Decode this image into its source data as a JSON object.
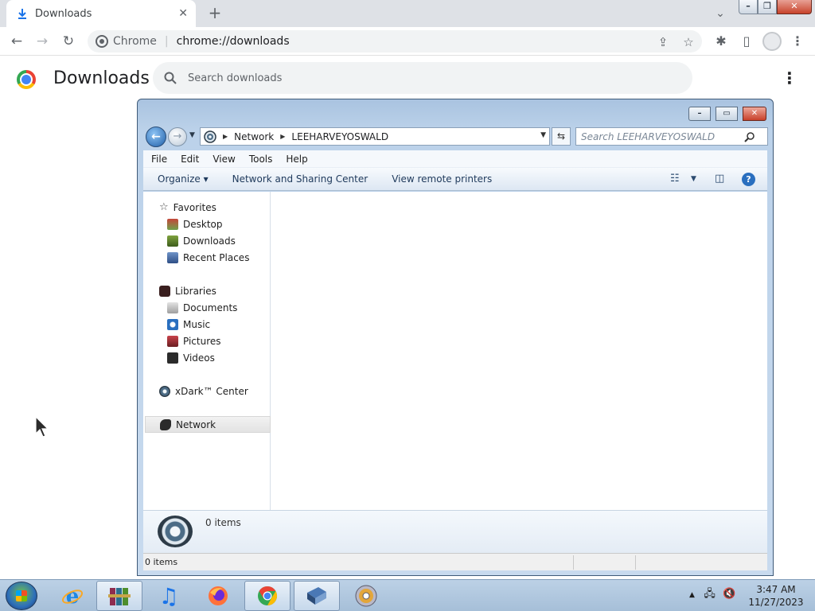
{
  "browser": {
    "tab": {
      "title": "Downloads",
      "icon": "download-icon",
      "close": "✕"
    },
    "new_tab_label": "+",
    "tab_search": "⌄",
    "window_controls": {
      "minimize": "–",
      "maximize": "❐",
      "close": "✕"
    },
    "omnibox": {
      "site_name": "Chrome",
      "url": "chrome://downloads"
    }
  },
  "downloads_page": {
    "title": "Downloads",
    "search_placeholder": "Search downloads",
    "menu": "⋮"
  },
  "explorer": {
    "window_controls": {
      "minimize": "–",
      "maximize": "▭",
      "close": "✕"
    },
    "breadcrumb": [
      "Network",
      "LEEHARVEYOSWALD"
    ],
    "search_placeholder": "Search LEEHARVEYOSWALD",
    "menu": [
      "File",
      "Edit",
      "View",
      "Tools",
      "Help"
    ],
    "commands": {
      "organize": "Organize ▾",
      "network_sharing": "Network and Sharing Center",
      "remote_printers": "View remote printers"
    },
    "help": "?",
    "nav": {
      "favorites": {
        "label": "Favorites",
        "items": [
          "Desktop",
          "Downloads",
          "Recent Places"
        ]
      },
      "libraries": {
        "label": "Libraries",
        "items": [
          "Documents",
          "Music",
          "Pictures",
          "Videos"
        ]
      },
      "xdark": "xDark™ Center",
      "network": "Network"
    },
    "details_count": "0 items",
    "status_count": "0 items"
  },
  "taskbar": {
    "clock": {
      "time": "3:47 AM",
      "date": "11/27/2023"
    },
    "tray_arrow": "▲"
  },
  "colors": {
    "chrome_tabstrip": "#dee1e6",
    "explorer_frame": "#bcd2ea",
    "taskbar": "#a6bfd8"
  }
}
